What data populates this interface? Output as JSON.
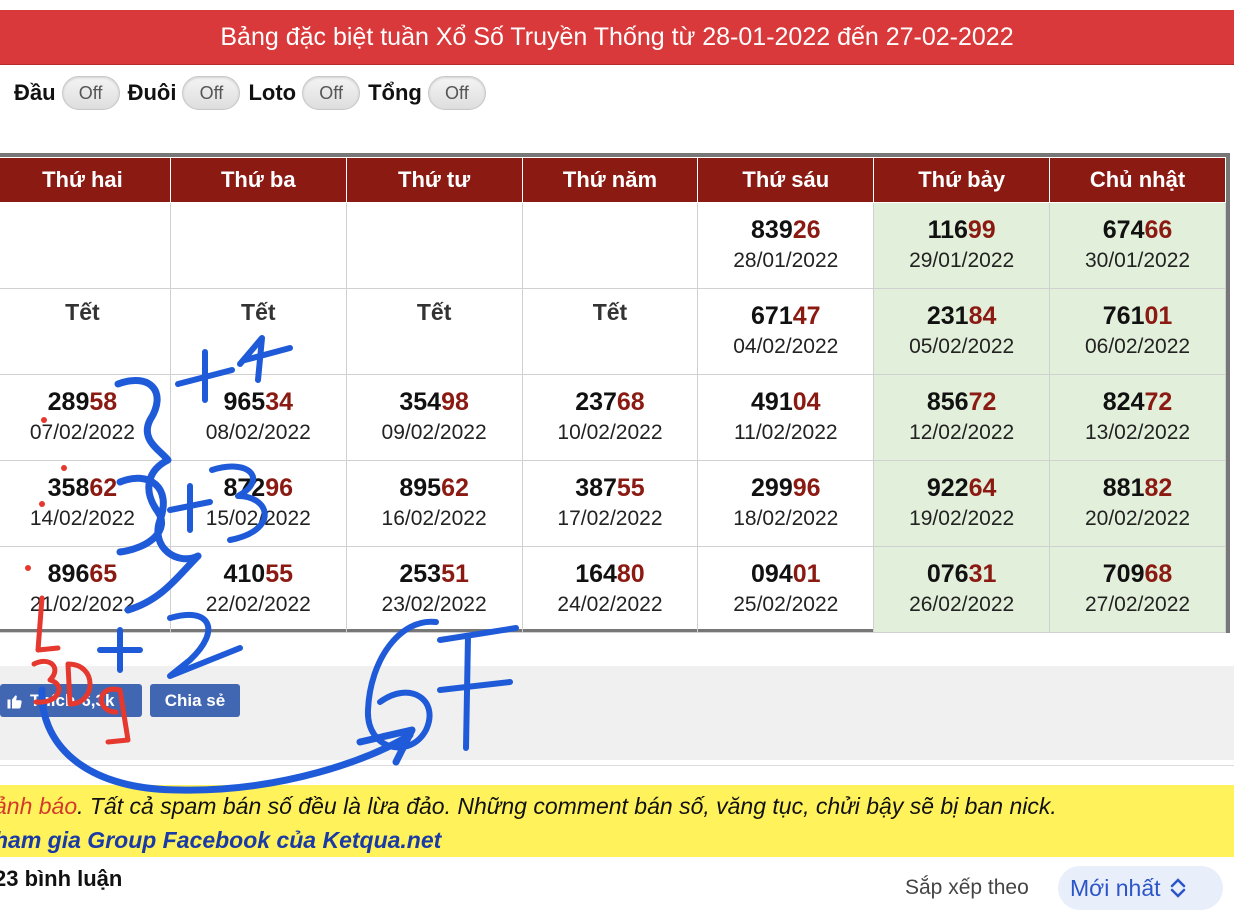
{
  "header": {
    "title": "Bảng đặc biệt tuần Xổ Số Truyền Thống từ 28-01-2022 đến 27-02-2022"
  },
  "toggles": [
    {
      "label": "Đầu",
      "state": "Off"
    },
    {
      "label": "Đuôi",
      "state": "Off"
    },
    {
      "label": "Loto",
      "state": "Off"
    },
    {
      "label": "Tổng",
      "state": "Off"
    }
  ],
  "table": {
    "headers": [
      "Thứ hai",
      "Thứ ba",
      "Thứ tư",
      "Thứ năm",
      "Thứ sáu",
      "Thứ bảy",
      "Chủ nhật"
    ],
    "rows": [
      [
        {
          "type": "empty"
        },
        {
          "type": "empty"
        },
        {
          "type": "empty"
        },
        {
          "type": "empty"
        },
        {
          "type": "num",
          "head": "839",
          "tail": "26",
          "date": "28/01/2022"
        },
        {
          "type": "num",
          "head": "116",
          "tail": "99",
          "date": "29/01/2022"
        },
        {
          "type": "num",
          "head": "674",
          "tail": "66",
          "date": "30/01/2022"
        }
      ],
      [
        {
          "type": "tet",
          "text": "Tết"
        },
        {
          "type": "tet",
          "text": "Tết"
        },
        {
          "type": "tet",
          "text": "Tết"
        },
        {
          "type": "tet",
          "text": "Tết"
        },
        {
          "type": "num",
          "head": "671",
          "tail": "47",
          "date": "04/02/2022"
        },
        {
          "type": "num",
          "head": "231",
          "tail": "84",
          "date": "05/02/2022"
        },
        {
          "type": "num",
          "head": "761",
          "tail": "01",
          "date": "06/02/2022"
        }
      ],
      [
        {
          "type": "num",
          "head": "289",
          "tail": "58",
          "date": "07/02/2022"
        },
        {
          "type": "num",
          "head": "965",
          "tail": "34",
          "date": "08/02/2022"
        },
        {
          "type": "num",
          "head": "354",
          "tail": "98",
          "date": "09/02/2022"
        },
        {
          "type": "num",
          "head": "237",
          "tail": "68",
          "date": "10/02/2022"
        },
        {
          "type": "num",
          "head": "491",
          "tail": "04",
          "date": "11/02/2022"
        },
        {
          "type": "num",
          "head": "856",
          "tail": "72",
          "date": "12/02/2022"
        },
        {
          "type": "num",
          "head": "824",
          "tail": "72",
          "date": "13/02/2022"
        }
      ],
      [
        {
          "type": "num",
          "head": "358",
          "tail": "62",
          "date": "14/02/2022"
        },
        {
          "type": "num",
          "head": "872",
          "tail": "96",
          "date": "15/02/2022"
        },
        {
          "type": "num",
          "head": "895",
          "tail": "62",
          "date": "16/02/2022"
        },
        {
          "type": "num",
          "head": "387",
          "tail": "55",
          "date": "17/02/2022"
        },
        {
          "type": "num",
          "head": "299",
          "tail": "96",
          "date": "18/02/2022"
        },
        {
          "type": "num",
          "head": "922",
          "tail": "64",
          "date": "19/02/2022"
        },
        {
          "type": "num",
          "head": "881",
          "tail": "82",
          "date": "20/02/2022"
        }
      ],
      [
        {
          "type": "num",
          "head": "896",
          "tail": "65",
          "date": "21/02/2022"
        },
        {
          "type": "num",
          "head": "410",
          "tail": "55",
          "date": "22/02/2022"
        },
        {
          "type": "num",
          "head": "253",
          "tail": "51",
          "date": "23/02/2022"
        },
        {
          "type": "num",
          "head": "164",
          "tail": "80",
          "date": "24/02/2022"
        },
        {
          "type": "num",
          "head": "094",
          "tail": "01",
          "date": "25/02/2022"
        },
        {
          "type": "num",
          "head": "076",
          "tail": "31",
          "date": "26/02/2022"
        },
        {
          "type": "num",
          "head": "709",
          "tail": "68",
          "date": "27/02/2022"
        }
      ]
    ]
  },
  "social": {
    "like_label": "Thích",
    "like_count": "6,3k",
    "share_label": "Chia sẻ"
  },
  "warning": {
    "prefix": "ảnh báo",
    "body": ". Tất cả spam bán số đều là lừa đảo. Những comment bán số, văng tục, chửi bậy sẽ bị ban nick.",
    "group": "ham gia Group Facebook của Ketqua.net"
  },
  "comments": {
    "count": "23 bình luận",
    "sort_label": "Sắp xếp theo",
    "sort_value": "Mới nhất"
  },
  "annotations": {
    "marks": [
      "+4",
      "+3",
      "+2",
      "3D",
      "9",
      "67"
    ],
    "colors": {
      "blue": "#1f5bd8",
      "red": "#e5382e"
    }
  },
  "colors": {
    "title_bg": "#d9393a",
    "header_bg": "#8b1a12",
    "tail_text": "#8b1a12",
    "weekend_bg": "#e2efda",
    "warning_bg": "#fff25a",
    "button_bg": "#4267b2"
  }
}
